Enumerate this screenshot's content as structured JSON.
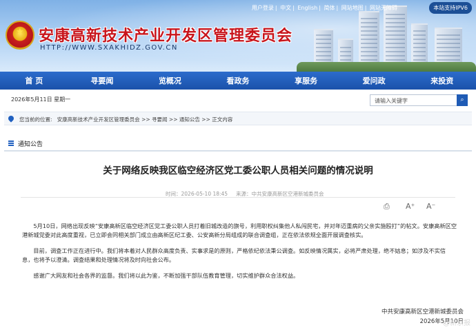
{
  "header": {
    "site_title": "安康高新技术产业开发区管理委员会",
    "site_url": "HTTP://WWW.SXAKHIDZ.GOV.CN",
    "top_links": [
      "用户登录",
      "中文",
      "English",
      "简体",
      "网站地图",
      "网站无障碍"
    ],
    "ipv6_badge": "本站支持IPV6"
  },
  "nav": {
    "items": [
      "首 页",
      "寻要闻",
      "览概况",
      "看政务",
      "享服务",
      "爱问政",
      "来投资"
    ]
  },
  "datebar": {
    "date": "2026年5月11日 星期一",
    "search_placeholder": "请输入关键字"
  },
  "breadcrumb": {
    "prefix": "您当前的位置:",
    "path": "安康高新技术产业开发区管理委员会 >> 寻要闻 >> 通知公告 >> 正文内容"
  },
  "section": {
    "label": "通知公告"
  },
  "article": {
    "title": "关于网络反映我区临空经济区党工委公职人员相关问题的情况说明",
    "time": "时间：2026-05-10 18:45",
    "source": "来源：中共安康高新区空港新城委员会",
    "tools": [
      "⎙",
      "A⁺",
      "A⁻"
    ],
    "paragraphs": [
      "5月10日，网络出现反映“安康高新区临空经济区党工委公职人员打着旧城改造的旗号，利用职权纠集他人私闯民宅，并对年迈重病的父亲实施殴打”的帖文。安康高新区空港新城党委对此高度重视，已立即会同相关部门成立由高新区纪工委、公安高新分局组成的联合调查组，正在依法依规全面开展调查核实。",
      "目前，调查工作正在进行中。我们将本着对人民群众高度负责、实事求是的原则，严格依纪依法秉公调查。如反映情况属实，必将严肃处理，绝不姑息；如涉及不实信息，也将予以澄清。调查结果和处理情况将及时向社会公布。",
      "感谢广大网友和社会各界的监督。我们将以此为鉴，不断加强干部队伍教育管理，切实维护群众合法权益。"
    ],
    "signer_org": "中共安康高新区空港新城委员会",
    "signer_date": "2026年5月10日"
  },
  "watermark": "@新京报"
}
